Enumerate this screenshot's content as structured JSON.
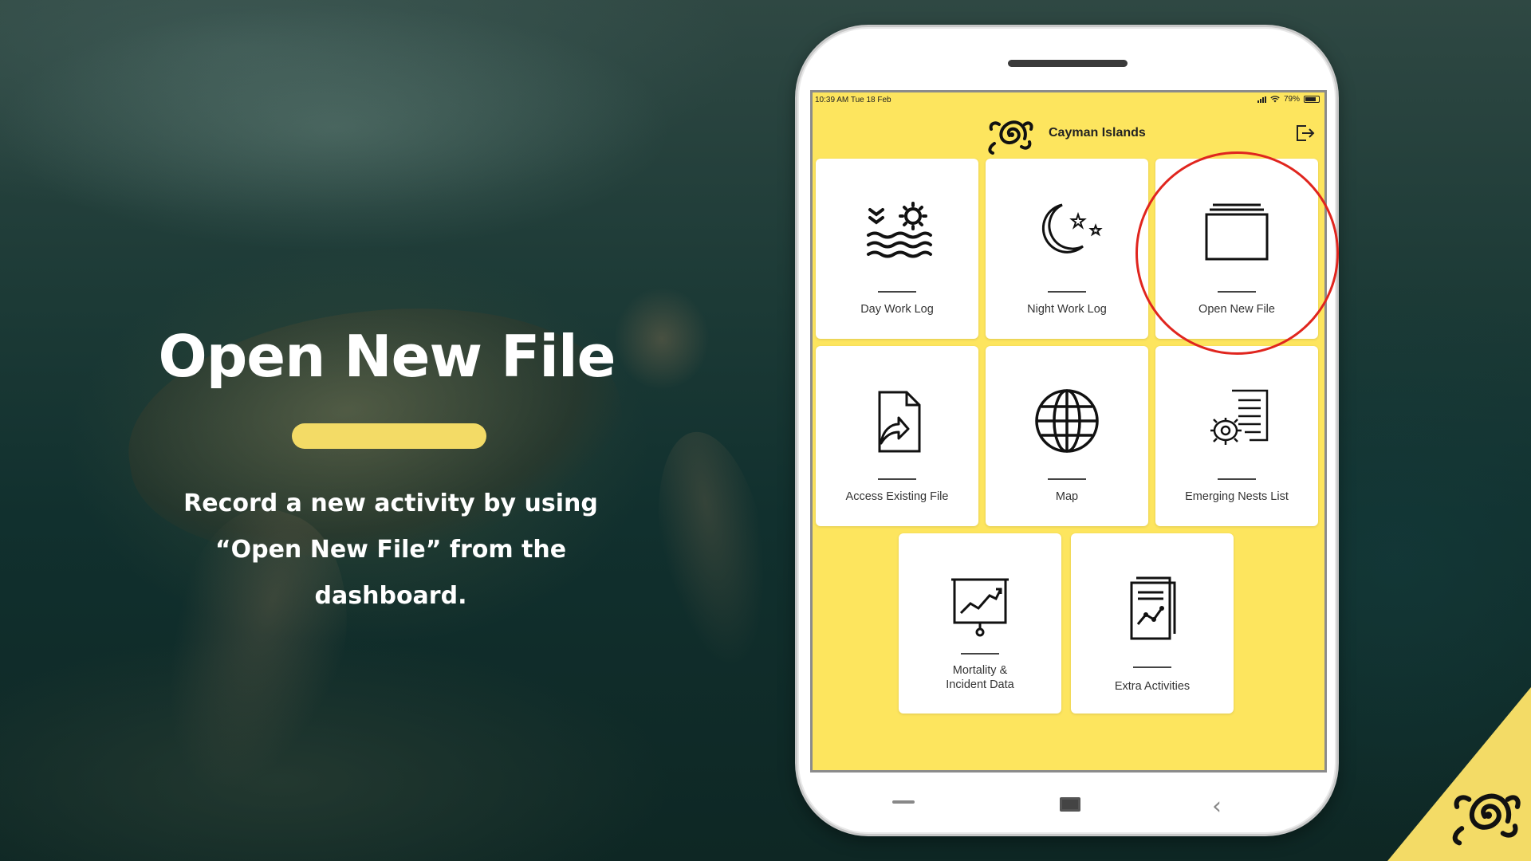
{
  "slide": {
    "title": "Open New File",
    "description_line1": "Record a new activity by using",
    "description_line2": "“Open New File” from the",
    "description_line3": "dashboard."
  },
  "status_bar": {
    "time": "10:39 AM   Tue 18 Feb",
    "battery": "79%",
    "battery_level": 0.79
  },
  "app": {
    "title": "Cayman Islands",
    "logo_icon": "turtle-logo-icon",
    "logout_icon": "logout-icon"
  },
  "tiles": [
    {
      "label": "Day Work Log",
      "icon": "sun-waves-icon"
    },
    {
      "label": "Night Work Log",
      "icon": "moon-stars-icon"
    },
    {
      "label": "Open New File",
      "icon": "folder-stack-icon"
    },
    {
      "label": "Access Existing File",
      "icon": "document-arrow-icon"
    },
    {
      "label": "Map",
      "icon": "globe-icon"
    },
    {
      "label": "Emerging Nests List",
      "icon": "turtle-list-icon"
    },
    {
      "label": "Mortality &\nIncident Data",
      "icon": "presentation-chart-icon"
    },
    {
      "label": "Extra Activities",
      "icon": "document-chart-icon"
    }
  ],
  "colors": {
    "screen_bg": "#fde55e",
    "accent_yellow": "#f3db66",
    "highlight_red": "#e0251e",
    "tile_bg": "#ffffff"
  }
}
